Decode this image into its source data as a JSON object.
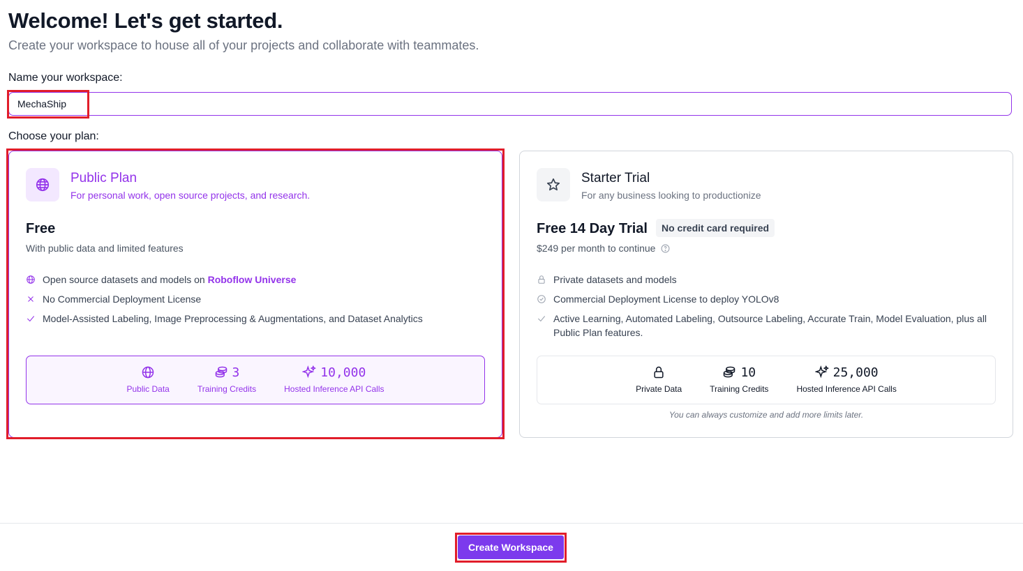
{
  "header": {
    "title": "Welcome! Let's get started.",
    "subtitle": "Create your workspace to house all of your projects and collaborate with teammates."
  },
  "workspace": {
    "label": "Name your workspace:",
    "value": "MechaShip"
  },
  "plan_section": {
    "label": "Choose your plan:"
  },
  "plans": [
    {
      "name": "Public Plan",
      "description": "For personal work, open source projects, and research.",
      "price_title": "Free",
      "price_subtitle": "With public data and limited features",
      "icon": "globe-icon",
      "selected": true,
      "features": [
        {
          "icon": "globe-icon",
          "text": "Open source datasets and models on ",
          "link": "Roboflow Universe"
        },
        {
          "icon": "x-icon",
          "text": "No Commercial Deployment License"
        },
        {
          "icon": "check-icon",
          "text": "Model-Assisted Labeling, Image Preprocessing & Augmentations, and Dataset Analytics"
        }
      ],
      "stats": [
        {
          "icon": "globe-icon",
          "value": "",
          "label": "Public Data"
        },
        {
          "icon": "coins-icon",
          "value": "3",
          "label": "Training Credits"
        },
        {
          "icon": "sparkles-icon",
          "value": "10,000",
          "label": "Hosted Inference API Calls"
        }
      ]
    },
    {
      "name": "Starter Trial",
      "description": "For any business looking to productionize",
      "price_title": "Free 14 Day Trial",
      "badge": "No credit card required",
      "price_subtitle": "$249 per month to continue",
      "icon": "star-icon",
      "selected": false,
      "features": [
        {
          "icon": "lock-icon",
          "text": "Private datasets and models"
        },
        {
          "icon": "check-circle-icon",
          "text": "Commercial Deployment License to deploy YOLOv8"
        },
        {
          "icon": "check-icon",
          "text": "Active Learning, Automated Labeling, Outsource Labeling, Accurate Train, Model Evaluation, plus all Public Plan features."
        }
      ],
      "stats": [
        {
          "icon": "lock-icon",
          "value": "",
          "label": "Private Data"
        },
        {
          "icon": "coins-icon",
          "value": "10",
          "label": "Training Credits"
        },
        {
          "icon": "sparkles-icon",
          "value": "25,000",
          "label": "Hosted Inference API Calls"
        }
      ],
      "note": "You can always customize and add more limits later."
    }
  ],
  "footer": {
    "create_button": "Create Workspace"
  },
  "colors": {
    "accent": "#9333ea",
    "button": "#7c3aed",
    "highlight": "#e11d2a"
  }
}
